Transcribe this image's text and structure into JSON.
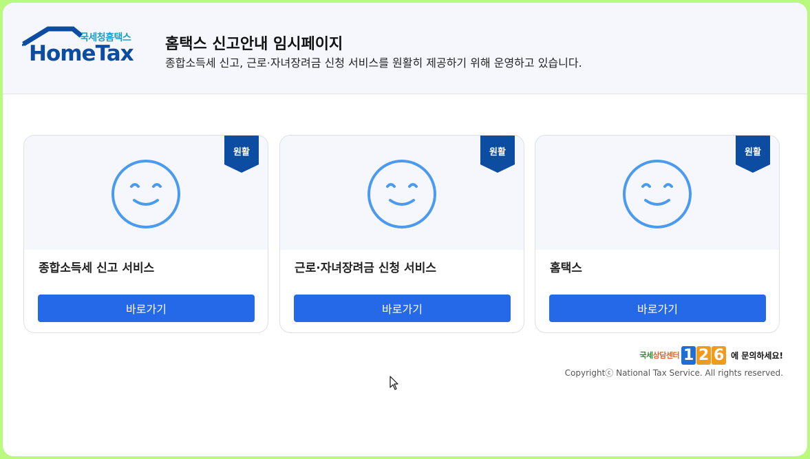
{
  "header": {
    "logo_korean": "국세청홈택스",
    "logo_english": "HomeTax",
    "title": "홈택스 신고안내 임시페이지",
    "subtitle": "종합소득세 신고, 근로·자녀장려금 신청 서비스를 원활히 제공하기 위해 운영하고 있습니다."
  },
  "cards": [
    {
      "status": "원활",
      "title": "종합소득세 신고 서비스",
      "button_label": "바로가기",
      "icon": "smile-icon"
    },
    {
      "status": "원활",
      "title": "근로·자녀장려금 신청 서비스",
      "button_label": "바로가기",
      "icon": "smile-icon"
    },
    {
      "status": "원활",
      "title": "홈택스",
      "button_label": "바로가기",
      "icon": "smile-icon"
    }
  ],
  "footer": {
    "help_center_part1": "국세",
    "help_center_part2": "상담센터",
    "help_digits": [
      "1",
      "2",
      "6"
    ],
    "help_tail": "에 문의하세요!",
    "copyright": "Copyrightⓒ National Tax Service. All rights reserved."
  },
  "colors": {
    "accent": "#2569e8",
    "badge": "#0c4da2",
    "face": "#4a9bf0",
    "frame": "#b9f97f"
  }
}
